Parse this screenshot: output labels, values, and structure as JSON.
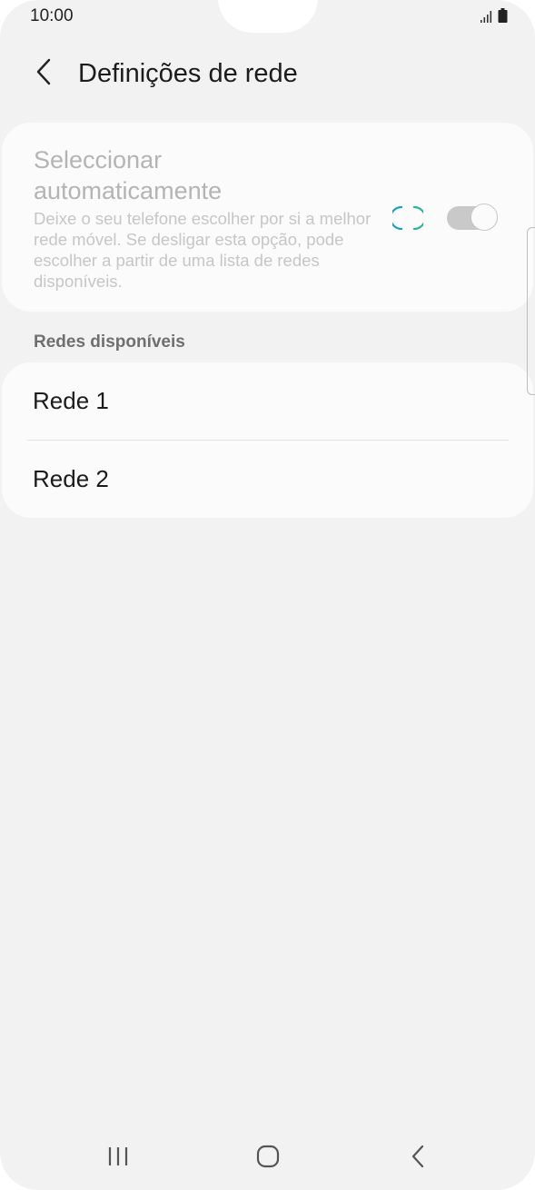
{
  "status_bar": {
    "time": "10:00",
    "icons": [
      "signal-icon",
      "battery-icon"
    ]
  },
  "header": {
    "title": "Definições de rede",
    "back_icon": "chevron-left-icon"
  },
  "auto_select": {
    "title": "Seleccionar automaticamente",
    "description": "Deixe o seu telefone escolher por si a melhor rede móvel. Se desligar esta opção, pode escolher a partir de uma lista de redes disponíveis.",
    "loading_icon": "spinner-icon",
    "toggle_state": "on (disabled)"
  },
  "networks_section": {
    "label": "Redes disponíveis",
    "items": [
      {
        "label": "Rede 1"
      },
      {
        "label": "Rede 2"
      }
    ]
  },
  "navigation_bar": {
    "buttons": [
      "recents-icon",
      "home-icon",
      "back-icon"
    ]
  },
  "colors": {
    "background": "#f2f2f2",
    "card": "#fbfbfb",
    "spinner_accent": "#1aa0b8",
    "disabled_text": "#b4b4b4"
  }
}
